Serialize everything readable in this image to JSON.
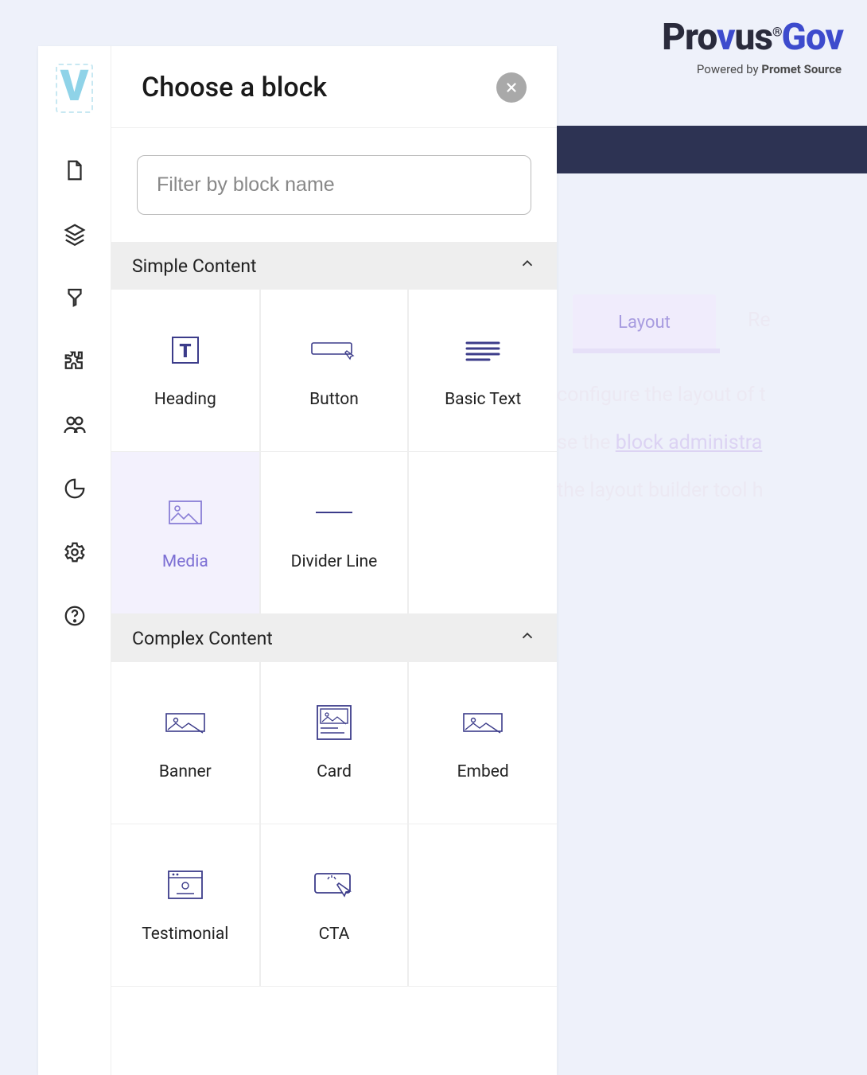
{
  "logo": {
    "part_pro": "Pro",
    "part_v": "v",
    "part_us": "us",
    "part_gov": "Gov",
    "reg": "®",
    "powered_prefix": "Powered by ",
    "powered_name": "Promet Source"
  },
  "background": {
    "tab_layout": "Layout",
    "tab_re": "Re",
    "line1_a": "configure the layout of t",
    "line2_a": "se the ",
    "line2_link": "block administra",
    "line3_a": "the layout builder tool h"
  },
  "dialog": {
    "title": "Choose a block",
    "filter_placeholder": "Filter by block name"
  },
  "sections": [
    {
      "title": "Simple Content",
      "blocks": [
        {
          "label": "Heading",
          "icon": "heading"
        },
        {
          "label": "Button",
          "icon": "button"
        },
        {
          "label": "Basic Text",
          "icon": "text"
        },
        {
          "label": "Media",
          "icon": "image",
          "selected": true
        },
        {
          "label": "Divider Line",
          "icon": "divider"
        }
      ]
    },
    {
      "title": "Complex Content",
      "blocks": [
        {
          "label": "Banner",
          "icon": "banner"
        },
        {
          "label": "Card",
          "icon": "card"
        },
        {
          "label": "Embed",
          "icon": "embed"
        },
        {
          "label": "Testimonial",
          "icon": "testimonial"
        },
        {
          "label": "CTA",
          "icon": "cta"
        }
      ]
    }
  ]
}
